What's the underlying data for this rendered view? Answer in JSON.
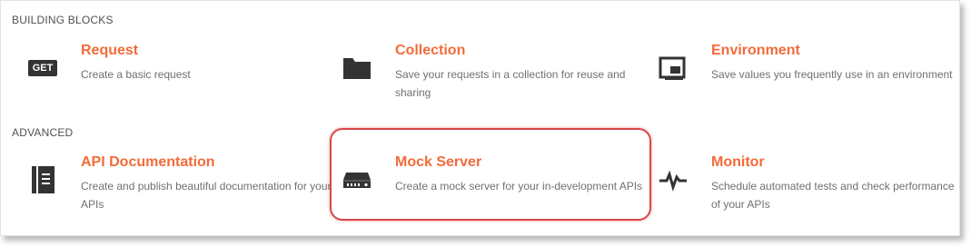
{
  "sections": {
    "building_blocks": {
      "title": "BUILDING BLOCKS",
      "items": [
        {
          "title": "Request",
          "desc": "Create a basic request",
          "icon": "get-icon",
          "icon_text": "GET"
        },
        {
          "title": "Collection",
          "desc": "Save your requests in a collection for reuse and sharing",
          "icon": "folder-icon"
        },
        {
          "title": "Environment",
          "desc": "Save values you frequently use in an environment",
          "icon": "environment-icon"
        }
      ]
    },
    "advanced": {
      "title": "ADVANCED",
      "items": [
        {
          "title": "API Documentation",
          "desc": "Create and publish beautiful documentation for your APIs",
          "icon": "documentation-icon"
        },
        {
          "title": "Mock Server",
          "desc": "Create a mock server for your in-development APIs",
          "icon": "server-icon"
        },
        {
          "title": "Monitor",
          "desc": "Schedule automated tests and check performance of your APIs",
          "icon": "pulse-icon"
        }
      ]
    }
  },
  "colors": {
    "title_accent": "#f26b3a",
    "highlight": "#d94848"
  }
}
